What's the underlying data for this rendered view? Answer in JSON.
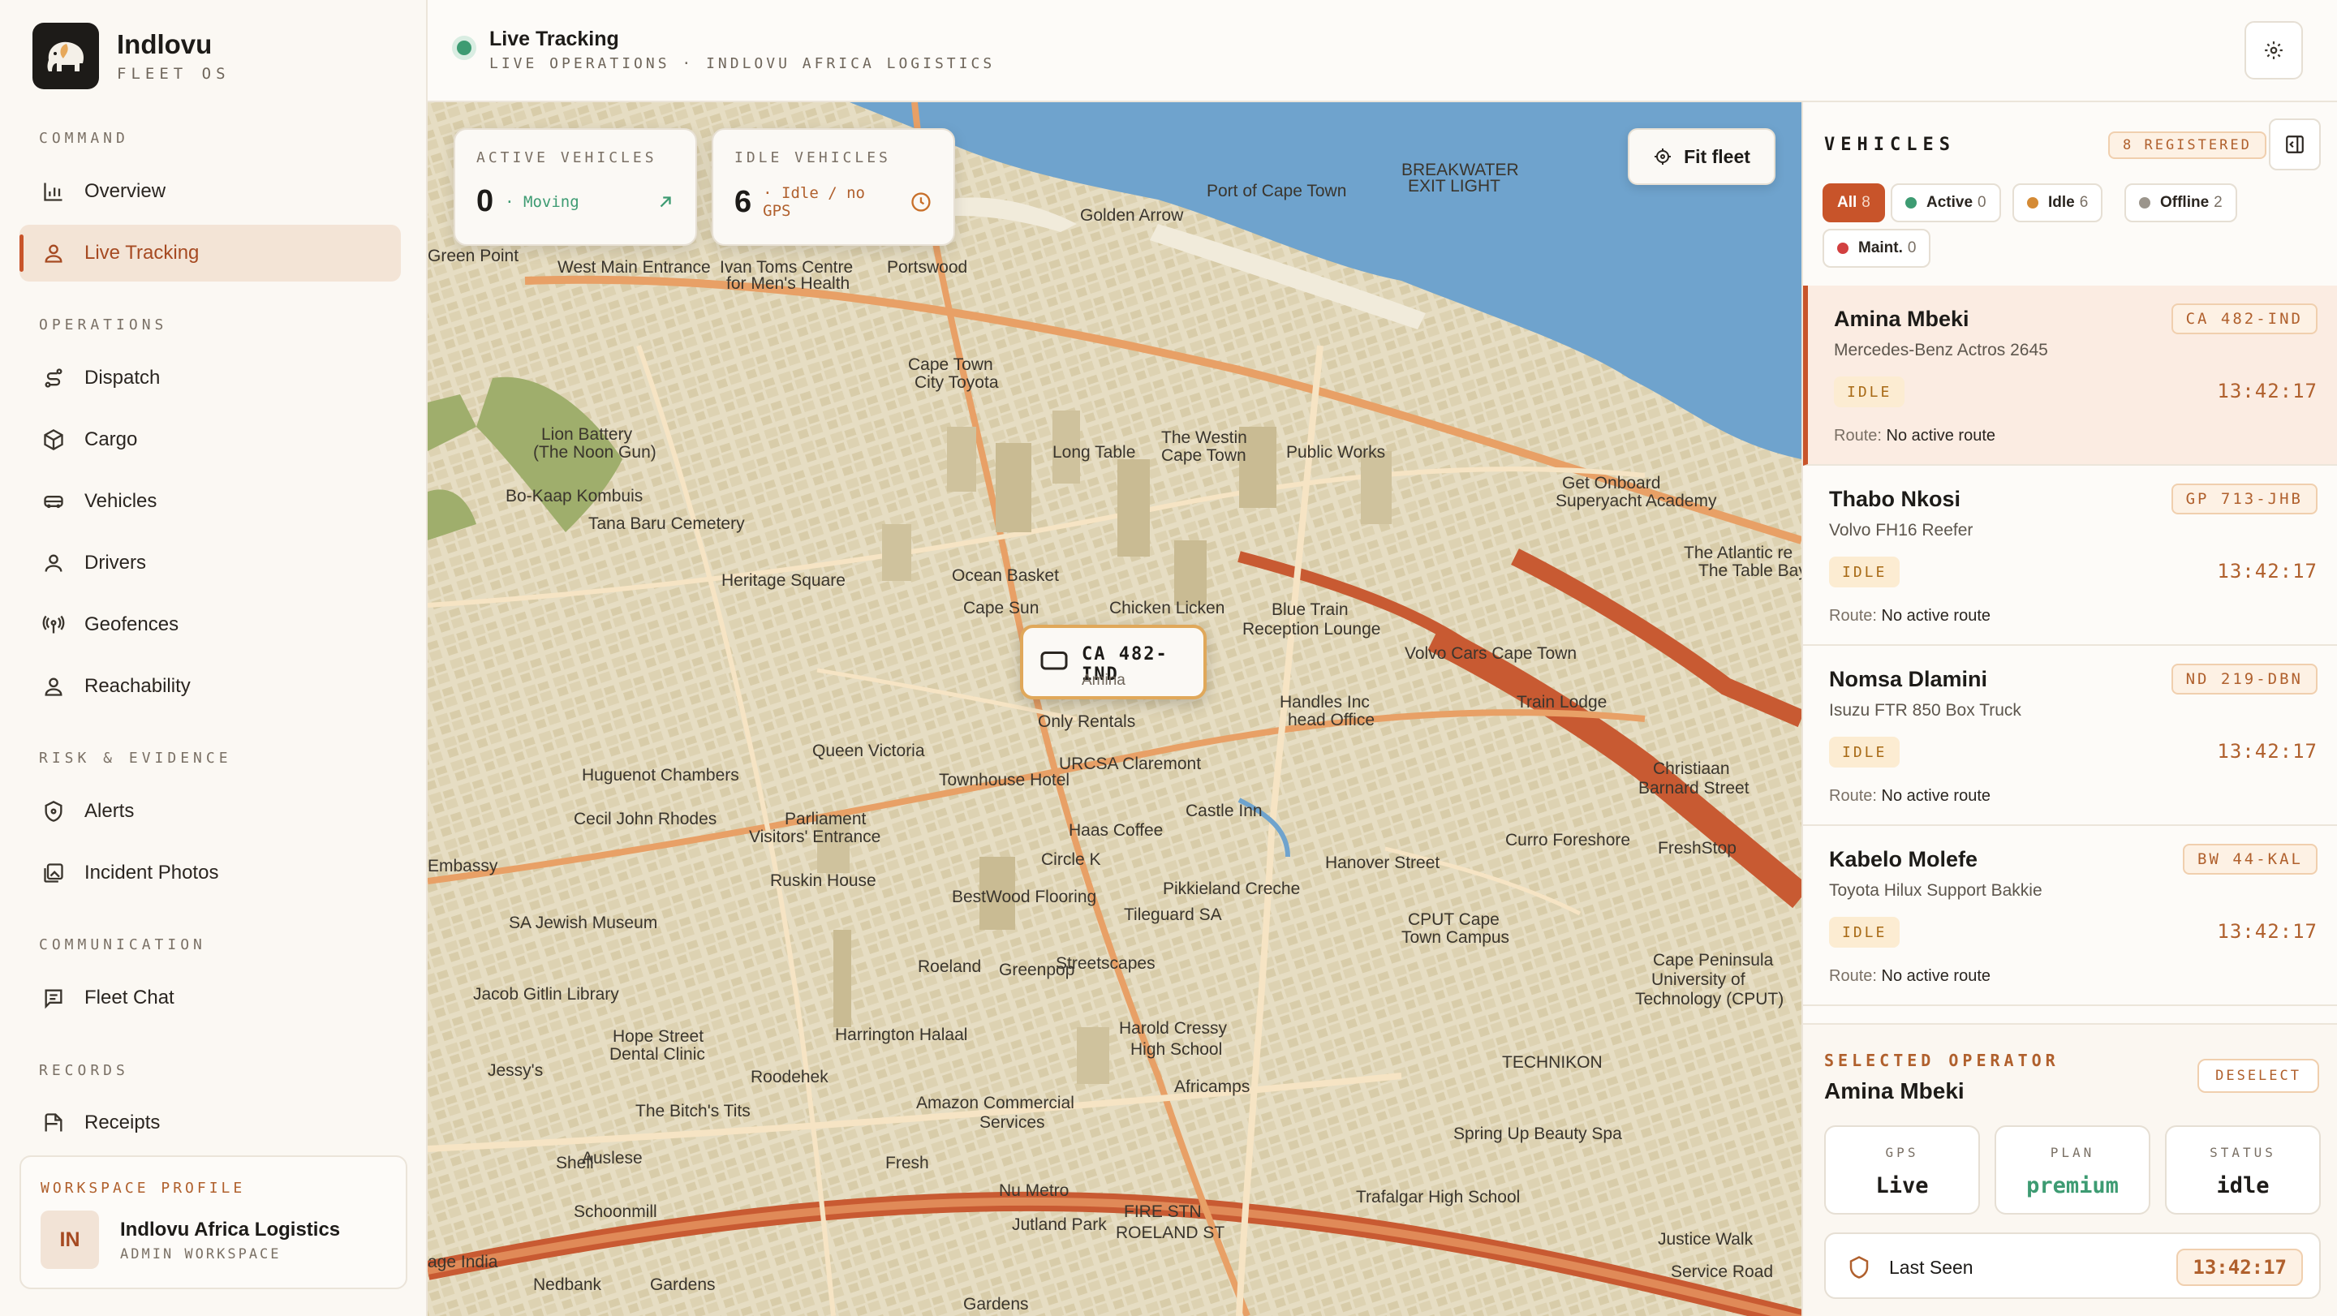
{
  "brand": {
    "name": "Indlovu",
    "subtitle": "FLEET OS"
  },
  "sidebar": {
    "sections": [
      {
        "label": "COMMAND"
      },
      {
        "label": "OPERATIONS"
      },
      {
        "label": "RISK & EVIDENCE"
      },
      {
        "label": "COMMUNICATION"
      },
      {
        "label": "RECORDS"
      }
    ],
    "items": [
      {
        "label": "Overview",
        "icon": "bar-chart-icon"
      },
      {
        "label": "Live Tracking",
        "icon": "user-pin-icon",
        "active": true
      },
      {
        "label": "Dispatch",
        "icon": "route-icon"
      },
      {
        "label": "Cargo",
        "icon": "box-icon"
      },
      {
        "label": "Vehicles",
        "icon": "truck-icon"
      },
      {
        "label": "Drivers",
        "icon": "user-icon"
      },
      {
        "label": "Geofences",
        "icon": "broadcast-icon"
      },
      {
        "label": "Reachability",
        "icon": "user-check-icon"
      },
      {
        "label": "Alerts",
        "icon": "shield-icon"
      },
      {
        "label": "Incident Photos",
        "icon": "photo-icon"
      },
      {
        "label": "Fleet Chat",
        "icon": "chat-icon"
      },
      {
        "label": "Receipts",
        "icon": "receipt-icon"
      }
    ]
  },
  "workspace": {
    "label": "WORKSPACE PROFILE",
    "initials": "IN",
    "name": "Indlovu Africa Logistics",
    "role": "ADMIN WORKSPACE"
  },
  "header": {
    "title": "Live Tracking",
    "subtitle": "LIVE OPERATIONS · INDLOVU AFRICA LOGISTICS"
  },
  "stats": {
    "active": {
      "label": "ACTIVE VEHICLES",
      "value": "0",
      "note": "· Moving"
    },
    "idle": {
      "label": "IDLE VEHICLES",
      "value": "6",
      "note": "· Idle / no GPS"
    }
  },
  "map": {
    "fit_label": "Fit fleet",
    "marker": {
      "plate": "CA 482-IND",
      "driver": "Amina"
    },
    "labels": [
      "Port of Cape Town",
      "BREAKWATER",
      "EXIT LIGHT",
      "Golden Arrow",
      "Green Point",
      "West Main Entrance",
      "Ivan Toms Centre",
      "for Men's Health",
      "Portswood",
      "Lion Battery",
      "(The Noon Gun)",
      "Bo-Kaap Kombuis",
      "Tana Baru Cemetery",
      "Cape Town",
      "City Toyota",
      "Long Table",
      "The Westin",
      "Cape Town",
      "Public Works",
      "Get Onboard",
      "Superyacht Academy",
      "The Atlantic re",
      "The Table Bay",
      "Heritage Square",
      "Ocean Basket",
      "Cape Sun",
      "Chicken Licken",
      "Blue Train",
      "Reception Lounge",
      "Volvo Cars Cape Town",
      "Only Rentals",
      "Handles Inc",
      "head Office",
      "Train Lodge",
      "Christiaan",
      "Barnard Street",
      "Queen Victoria",
      "Townhouse Hotel",
      "URCSA Claremont",
      "Huguenot Chambers",
      "Cecil John Rhodes",
      "Parliament",
      "Visitors' Entrance",
      "Haas Coffee",
      "Castle Inn",
      "Curro Foreshore",
      "FreshStop",
      "Embassy",
      "Ruskin House",
      "Circle K",
      "Pikkieland Creche",
      "Hanover Street",
      "BestWood Flooring",
      "Tileguard SA",
      "CPUT Cape",
      "Town Campus",
      "Cape Peninsula",
      "University of",
      "Technology (CPUT)",
      "SA Jewish Museum",
      "Jacob Gitlin Library",
      "Roeland",
      "Greenpop",
      "Streetscapes",
      "Hope Street",
      "Dental Clinic",
      "Harrington Halaal",
      "Harold Cressy",
      "High School",
      "TECHNIKON",
      "Jessy's",
      "Roodehek",
      "The Bitch's Tits",
      "Amazon Commercial",
      "Services",
      "Africamps",
      "Spring Up Beauty Spa",
      "Auslese",
      "Shell",
      "Fresh",
      "Nu Metro",
      "Trafalgar High School",
      "Schoonmill",
      "Jutland Park",
      "FIRE STN",
      "ROELAND ST",
      "Justice Walk",
      "age India",
      "Nedbank",
      "Gardens",
      "Service Road",
      "Gardens"
    ]
  },
  "panel": {
    "title": "VEHICLES",
    "registered": "8 REGISTERED",
    "filters": [
      {
        "label": "All",
        "count": "8",
        "color": ""
      },
      {
        "label": "Active",
        "count": "0",
        "color": "#3d9b72"
      },
      {
        "label": "Idle",
        "count": "6",
        "color": "#d48a35"
      },
      {
        "label": "Offline",
        "count": "2",
        "color": "#9b958c"
      },
      {
        "label": "Maint.",
        "count": "0",
        "color": "#d24040"
      }
    ],
    "vehicles": [
      {
        "name": "Amina Mbeki",
        "model": "Mercedes-Benz Actros 2645",
        "plate": "CA 482-IND",
        "status": "IDLE",
        "time": "13:42:17",
        "route_key": "Route:",
        "route": "No active route"
      },
      {
        "name": "Thabo Nkosi",
        "model": "Volvo FH16 Reefer",
        "plate": "GP 713-JHB",
        "status": "IDLE",
        "time": "13:42:17",
        "route_key": "Route:",
        "route": "No active route"
      },
      {
        "name": "Nomsa Dlamini",
        "model": "Isuzu FTR 850 Box Truck",
        "plate": "ND 219-DBN",
        "status": "IDLE",
        "time": "13:42:17",
        "route_key": "Route:",
        "route": "No active route"
      },
      {
        "name": "Kabelo Molefe",
        "model": "Toyota Hilux Support Bakkie",
        "plate": "BW 44-KAL",
        "status": "IDLE",
        "time": "13:42:17",
        "route_key": "Route:",
        "route": "No active route"
      }
    ],
    "selected": {
      "label": "SELECTED OPERATOR",
      "name": "Amina Mbeki",
      "deselect": "DESELECT",
      "gps_key": "GPS",
      "gps": "Live",
      "plan_key": "PLAN",
      "plan": "premium",
      "status_key": "STATUS",
      "status": "idle",
      "last_seen_key": "Last Seen",
      "last_seen": "13:42:17"
    }
  },
  "colors": {
    "accent": "#c8542a",
    "active": "#3d9b72",
    "idle": "#d48a35",
    "water": "#6fa3cd",
    "park": "#9fae6c"
  }
}
